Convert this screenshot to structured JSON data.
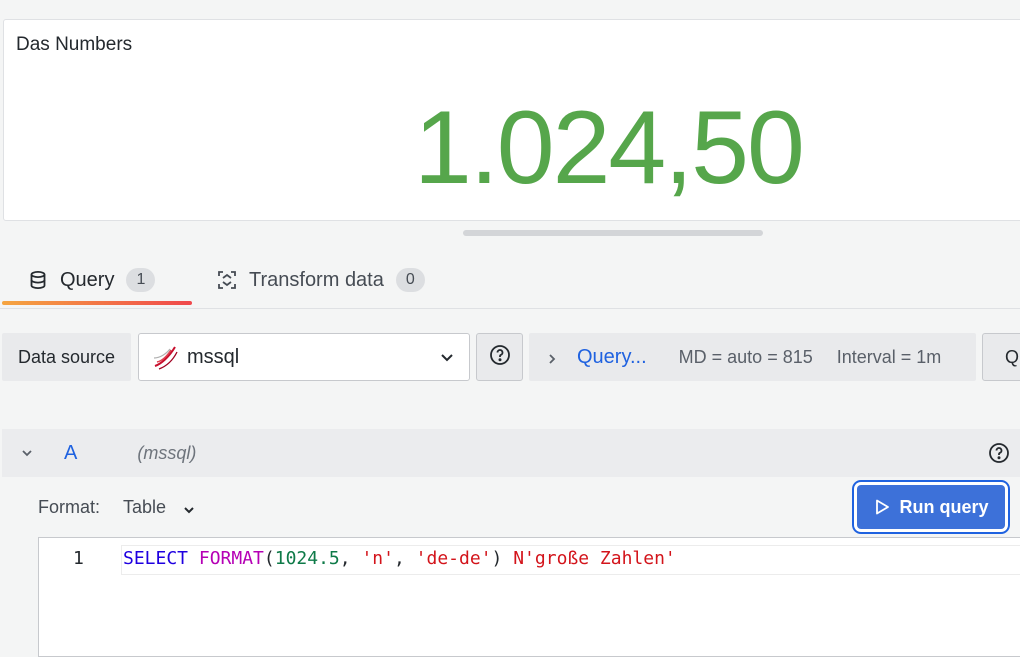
{
  "panel": {
    "title": "Das Numbers",
    "value": "1.024,50",
    "value_color": "#56a64b"
  },
  "tabs": [
    {
      "label": "Query",
      "count": "1",
      "icon": "database-icon",
      "active": true
    },
    {
      "label": "Transform data",
      "count": "0",
      "icon": "transform-icon",
      "active": false
    }
  ],
  "datasource": {
    "label": "Data source",
    "selected": "mssql",
    "logo": "mssql-logo-icon"
  },
  "query_options": {
    "label": "Query...",
    "max_data_points": "MD = auto = 815",
    "interval": "Interval = 1m"
  },
  "query_inspector": {
    "label": "Q"
  },
  "query_row": {
    "ref_id": "A",
    "datasource_name": "(mssql)"
  },
  "format": {
    "label": "Format:",
    "value": "Table"
  },
  "run_query": {
    "label": "Run query"
  },
  "editor": {
    "line_number": "1",
    "tokens": {
      "kw": "SELECT",
      "fn": "FORMAT",
      "open": "(",
      "num": "1024.5",
      "sep1": ", ",
      "str1": "'n'",
      "sep2": ", ",
      "str2": "'de-de'",
      "close": ") ",
      "str3": "N'große Zahlen'"
    }
  },
  "colors": {
    "accent": "#1f62e0",
    "run_button": "#3d71d9",
    "tab_gradient_start": "#f5a541",
    "tab_gradient_end": "#f0484c"
  }
}
